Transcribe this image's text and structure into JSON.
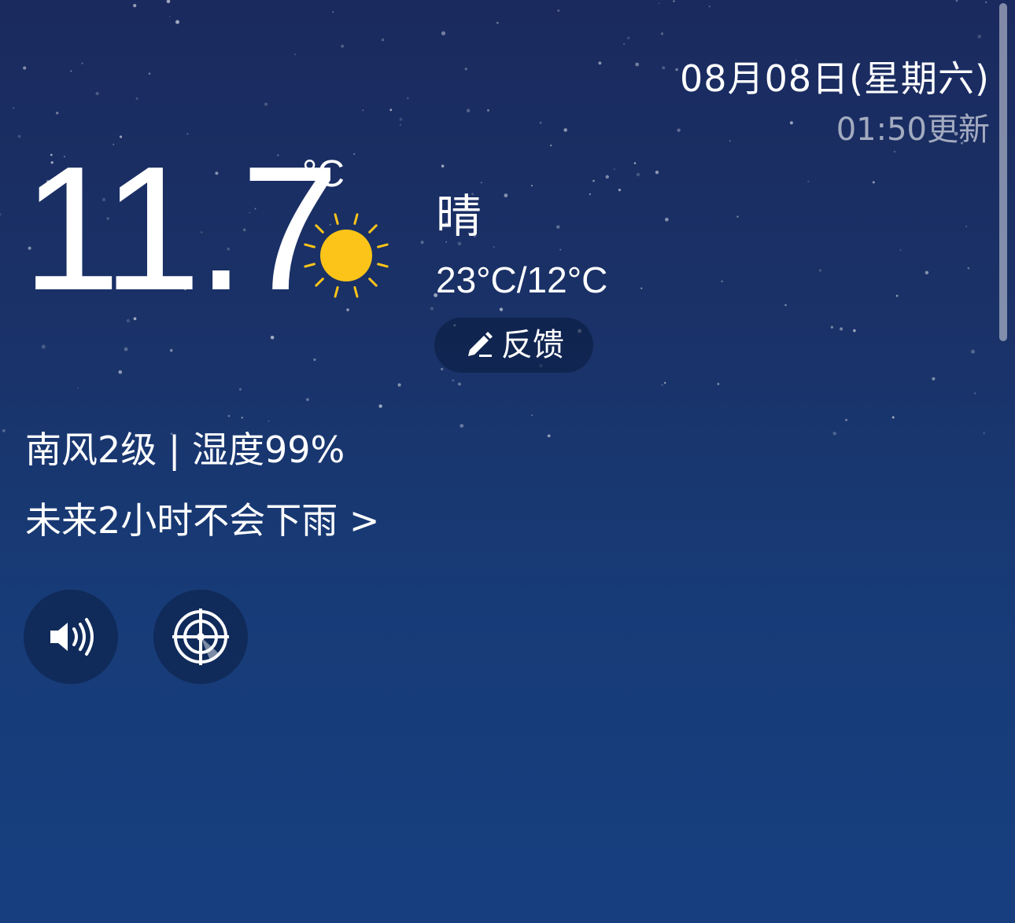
{
  "header": {
    "date": "08月08日(星期六)",
    "update_time": "01:50更新"
  },
  "current": {
    "temperature": "11.7",
    "unit": "°C",
    "condition": "晴",
    "range": "23°C/12°C",
    "condition_icon": "sun-icon"
  },
  "feedback": {
    "label": "反馈",
    "icon": "pencil-icon"
  },
  "details": {
    "wind_humidity": "南风2级 | 湿度99%",
    "rain_forecast": "未来2小时不会下雨 >"
  },
  "actions": {
    "sound_icon": "speaker-icon",
    "radar_icon": "radar-icon"
  },
  "colors": {
    "sun": "#fcc419",
    "background_top": "#1a2a5e",
    "background_bottom": "#173f7f"
  }
}
